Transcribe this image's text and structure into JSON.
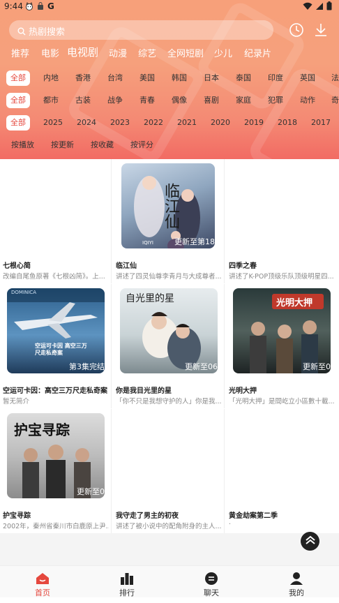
{
  "status_bar": {
    "time": "9:44",
    "app_icons": [
      "cat-face-icon",
      "shopping-bag-icon",
      "google-g-icon"
    ],
    "g_letter": "G"
  },
  "search": {
    "placeholder": "热剧搜索"
  },
  "header_actions": [
    "history-clock-icon",
    "download-icon"
  ],
  "categories": [
    "推荐",
    "电影",
    "电视剧",
    "动漫",
    "综艺",
    "全网短剧",
    "少儿",
    "纪录片"
  ],
  "active_category": "电视剧",
  "filters": {
    "region": [
      "全部",
      "内地",
      "香港",
      "台湾",
      "美国",
      "韩国",
      "日本",
      "泰国",
      "印度",
      "英国",
      "法"
    ],
    "genre": [
      "全部",
      "都市",
      "古装",
      "战争",
      "青春",
      "偶像",
      "喜剧",
      "家庭",
      "犯罪",
      "动作",
      "奇"
    ],
    "year": [
      "全部",
      "2025",
      "2024",
      "2023",
      "2022",
      "2021",
      "2020",
      "2019",
      "2018",
      "2017"
    ]
  },
  "sort": [
    "按播放",
    "按更新",
    "按收藏",
    "按评分"
  ],
  "items": [
    {
      "title": "七根心简",
      "desc": "改编自尾鱼原著《七根凶简》。上...",
      "badge": "",
      "poster": false
    },
    {
      "title": "临江仙",
      "desc": "讲述了四灵仙尊李青月与大成尊者...",
      "badge": "更新至第18",
      "poster": true,
      "poster_text": "临江仙",
      "poster_tag": "IQIYI"
    },
    {
      "title": "四季之春",
      "desc": "讲述了K-POP顶级乐队顶级明星四...",
      "badge": "",
      "poster": false
    },
    {
      "title": "空运可卡因：高空三万尺走私奇案",
      "desc": "暂无简介",
      "badge": "第3集完结",
      "poster": true,
      "poster_text": "空运可卡因 高空三万尺走私奇案",
      "poster_tag": "DOMINICA"
    },
    {
      "title": "你是我目光里的星",
      "desc": "「你不只是我想守护的人」你是我...",
      "badge": "更新至06",
      "poster": true,
      "poster_text": "自光里的星",
      "poster_tag": ""
    },
    {
      "title": "光明大押",
      "desc": "「光明大押」是間屹立小區數十載...",
      "badge": "更新至0",
      "poster": true,
      "poster_text": "光明大押",
      "poster_tag": ""
    },
    {
      "title": "护宝寻踪",
      "desc": "2002年，秦州省秦川市白鹿原上尹...",
      "badge": "更新至0",
      "poster": true,
      "poster_text": "护宝寻踪",
      "poster_tag": ""
    },
    {
      "title": "我守走了男主的初夜",
      "desc": "讲述了被小说中的配角附身的主人...",
      "badge": "",
      "poster": false
    },
    {
      "title": "黄金劫案第二季",
      "desc": "·",
      "badge": "",
      "poster": false
    }
  ],
  "back_to_top": "chevron-up-icon",
  "tabs": [
    {
      "label": "首页",
      "icon": "home-icon",
      "active": true
    },
    {
      "label": "排行",
      "icon": "bar-chart-icon",
      "active": false
    },
    {
      "label": "聊天",
      "icon": "chat-icon",
      "active": false
    },
    {
      "label": "我的",
      "icon": "user-icon",
      "active": false
    }
  ],
  "colors": {
    "accent": "#e5483e",
    "header_top": "#f7a07a",
    "header_bottom": "#f26b63"
  }
}
